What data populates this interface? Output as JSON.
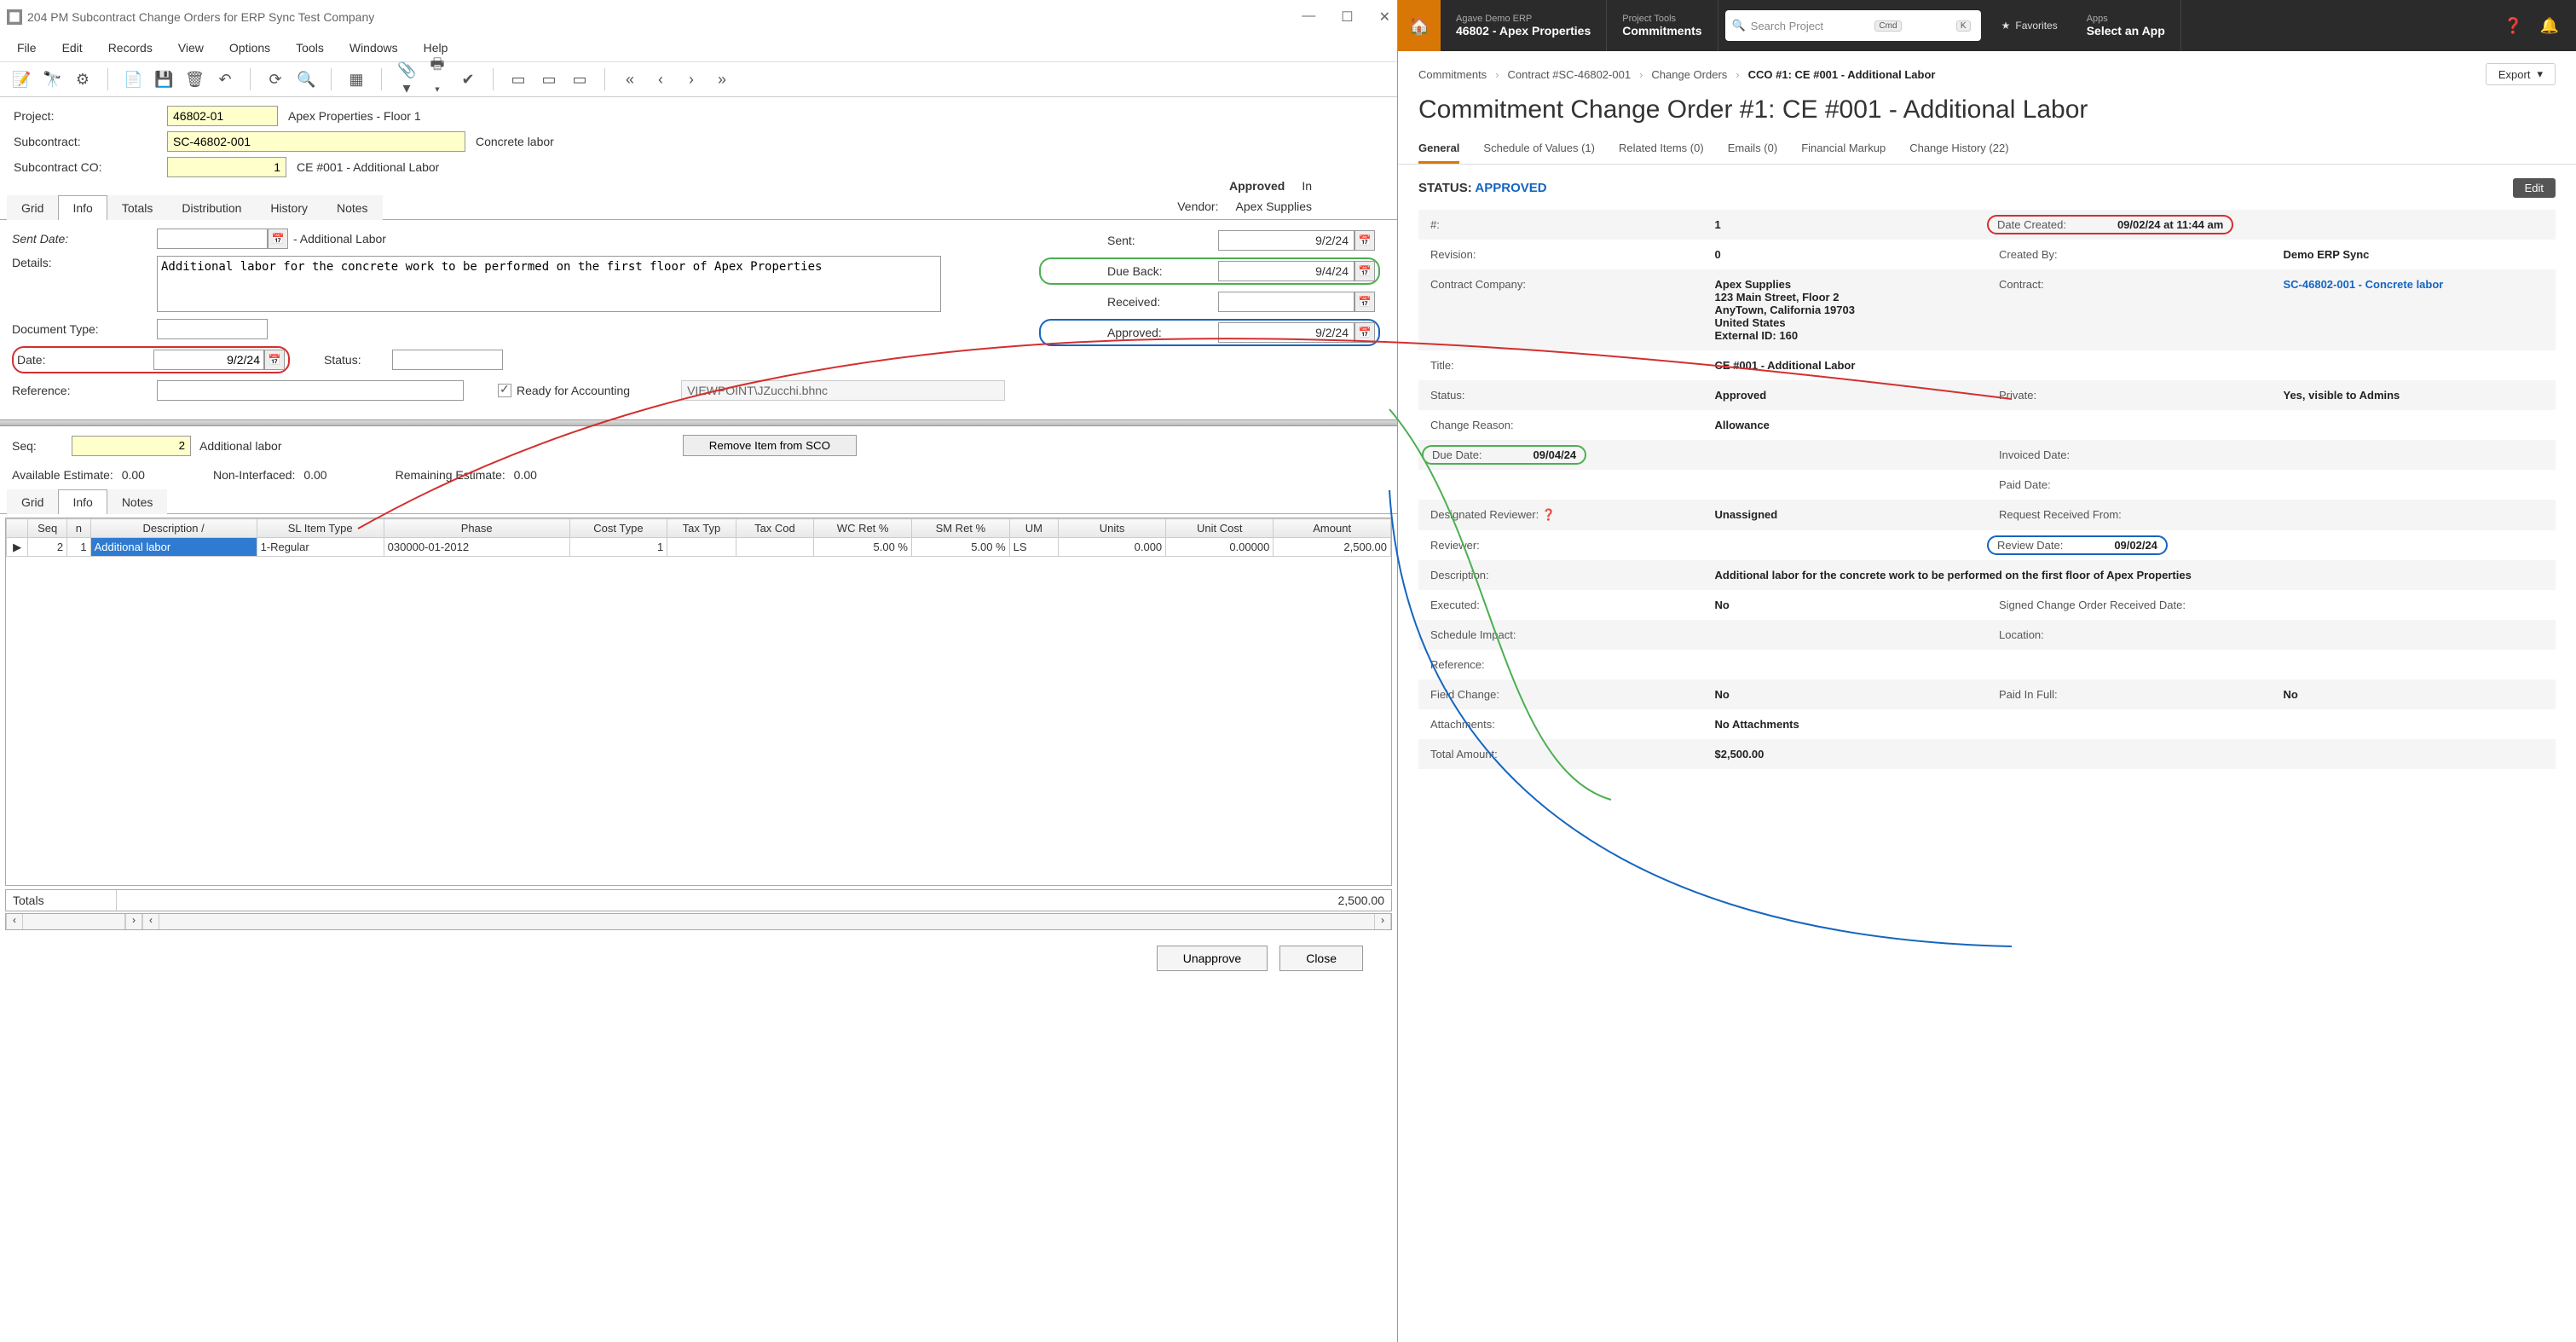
{
  "left": {
    "title": "204 PM Subcontract Change Orders for ERP Sync Test Company",
    "menu": [
      "File",
      "Edit",
      "Records",
      "View",
      "Options",
      "Tools",
      "Windows",
      "Help"
    ],
    "header": {
      "project_label": "Project:",
      "project_code": "46802-01",
      "project_name": "Apex Properties - Floor 1",
      "subcontract_label": "Subcontract:",
      "subcontract_code": "SC-46802-001",
      "subcontract_name": "Concrete labor",
      "sco_label": "Subcontract CO:",
      "sco_num": "1",
      "sco_name": "CE #001 - Additional Labor",
      "approved": "Approved",
      "intf": "In",
      "vendor_label": "Vendor:",
      "vendor": "Apex Supplies"
    },
    "tabs": [
      "Grid",
      "Info",
      "Totals",
      "Distribution",
      "History",
      "Notes"
    ],
    "active_tab": "Info",
    "info": {
      "sent_date_label": "Sent Date:",
      "sent_date_suffix": "- Additional Labor",
      "details_label": "Details:",
      "details": "Additional labor for the concrete work to be performed on the first floor of Apex Properties",
      "document_type_label": "Document Type:",
      "date_label": "Date:",
      "date": "9/2/24",
      "status_label": "Status:",
      "reference_label": "Reference:",
      "ready_label": "Ready for Accounting",
      "viewpoint": "VIEWPOINT\\JZucchi.bhnc",
      "right_dates": {
        "sent_label": "Sent:",
        "sent": "9/2/24",
        "dueback_label": "Due Back:",
        "dueback": "9/4/24",
        "received_label": "Received:",
        "received": "",
        "approved_label": "Approved:",
        "approved": "9/2/24"
      }
    },
    "seq": {
      "seq_label": "Seq:",
      "seq_num": "2",
      "seq_name": "Additional labor",
      "remove_btn": "Remove Item from SCO",
      "available_label": "Available Estimate:",
      "available": "0.00",
      "noninterfaced_label": "Non-Interfaced:",
      "noninterfaced": "0.00",
      "remaining_label": "Remaining Estimate:",
      "remaining": "0.00"
    },
    "subtabs": [
      "Grid",
      "Info",
      "Notes"
    ],
    "grid": {
      "cols": [
        "Seq",
        "n",
        "Description  /",
        "SL Item Type",
        "Phase",
        "Cost Type",
        "Tax Typ",
        "Tax Cod",
        "WC Ret %",
        "SM Ret %",
        "UM",
        "Units",
        "Unit Cost",
        "Amount"
      ],
      "row": {
        "seq": "2",
        "n": "1",
        "desc": "Additional labor",
        "sltype": "1-Regular",
        "phase": "030000-01-2012",
        "cost": "1",
        "taxtype": "",
        "taxcode": "",
        "wc": "5.00 %",
        "sm": "5.00 %",
        "um": "LS",
        "units": "0.000",
        "unitcost": "0.00000",
        "amount": "2,500.00"
      },
      "totals_label": "Totals",
      "totals_amount": "2,500.00"
    },
    "footer": {
      "unapprove": "Unapprove",
      "close": "Close"
    }
  },
  "right": {
    "nav": {
      "erp_small": "Agave Demo ERP",
      "erp_big": "46802 - Apex Properties",
      "tools_small": "Project Tools",
      "tools_big": "Commitments",
      "search_placeholder": "Search Project",
      "kbd1": "Cmd",
      "kbd2": "K",
      "favorites": "Favorites",
      "apps_small": "Apps",
      "apps_big": "Select an App"
    },
    "crumbs": [
      "Commitments",
      "Contract #SC-46802-001",
      "Change Orders",
      "CCO #1: CE #001 - Additional Labor"
    ],
    "export": "Export",
    "title": "Commitment Change Order #1: CE #001 - Additional Labor",
    "tabs": [
      "General",
      "Schedule of Values (1)",
      "Related Items (0)",
      "Emails (0)",
      "Financial Markup",
      "Change History (22)"
    ],
    "status_label": "STATUS:",
    "status_value": "APPROVED",
    "edit_btn": "Edit",
    "details": {
      "num_label": "#:",
      "num": "1",
      "date_created_label": "Date Created:",
      "date_created": "09/02/24 at 11:44 am",
      "revision_label": "Revision:",
      "revision": "0",
      "created_by_label": "Created By:",
      "created_by": "Demo ERP Sync",
      "contract_company_label": "Contract Company:",
      "company_name": "Apex Supplies",
      "company_addr1": "123 Main Street, Floor 2",
      "company_addr2": "AnyTown, California 19703",
      "company_country": "United States",
      "company_ext": "External ID: 160",
      "contract_label": "Contract:",
      "contract": "SC-46802-001 - Concrete labor",
      "title_label": "Title:",
      "title_val": "CE #001 - Additional Labor",
      "status_label2": "Status:",
      "status_val2": "Approved",
      "private_label": "Private:",
      "private": "Yes, visible to Admins",
      "change_reason_label": "Change Reason:",
      "change_reason": "Allowance",
      "due_date_label": "Due Date:",
      "due_date": "09/04/24",
      "invoiced_label": "Invoiced Date:",
      "invoiced": "",
      "paid_label": "Paid Date:",
      "paid": "",
      "designated_label": "Designated Reviewer:",
      "designated": "Unassigned",
      "request_label": "Request Received From:",
      "request": "",
      "reviewer_label": "Reviewer:",
      "reviewer": "",
      "review_date_label": "Review Date:",
      "review_date": "09/02/24",
      "description_label": "Description:",
      "description": "Additional labor for the concrete work to be performed on the first floor of Apex Properties",
      "executed_label": "Executed:",
      "executed": "No",
      "signed_label": "Signed Change Order Received Date:",
      "signed": "",
      "schedule_label": "Schedule Impact:",
      "schedule": "",
      "location_label": "Location:",
      "location": "",
      "reference_label": "Reference:",
      "reference": "",
      "field_change_label": "Field Change:",
      "field_change": "No",
      "paid_full_label": "Paid In Full:",
      "paid_full": "No",
      "attachments_label": "Attachments:",
      "attachments": "No Attachments",
      "total_label": "Total Amount:",
      "total": "$2,500.00"
    }
  }
}
